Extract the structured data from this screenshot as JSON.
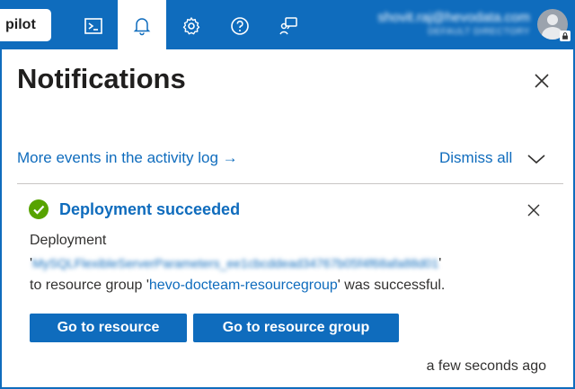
{
  "topbar": {
    "copilot_label": "pilot",
    "icons": [
      "cloud-shell-icon",
      "bell-icon",
      "gear-icon",
      "help-icon",
      "feedback-icon"
    ],
    "account_email": "shovit.raj@hevodata.com",
    "account_directory": "DEFAULT DIRECTORY",
    "accent_color": "#0f6cbd"
  },
  "panel": {
    "title": "Notifications",
    "activity_link": "More events in the activity log →",
    "dismiss_all": "Dismiss all"
  },
  "notification": {
    "title": "Deployment succeeded",
    "status_color": "#57a300",
    "message_prefix": "Deployment",
    "resource_name": "MySQLFlexibleServerParameters_ee1cbcddead34767b05f4f68afa88d01",
    "message_mid": "to resource group",
    "resource_group": "hevo-docteam-resourcegroup",
    "message_suffix": "was successful.",
    "go_to_resource": "Go to resource",
    "go_to_resource_group": "Go to resource group",
    "timestamp": "a few seconds ago"
  }
}
